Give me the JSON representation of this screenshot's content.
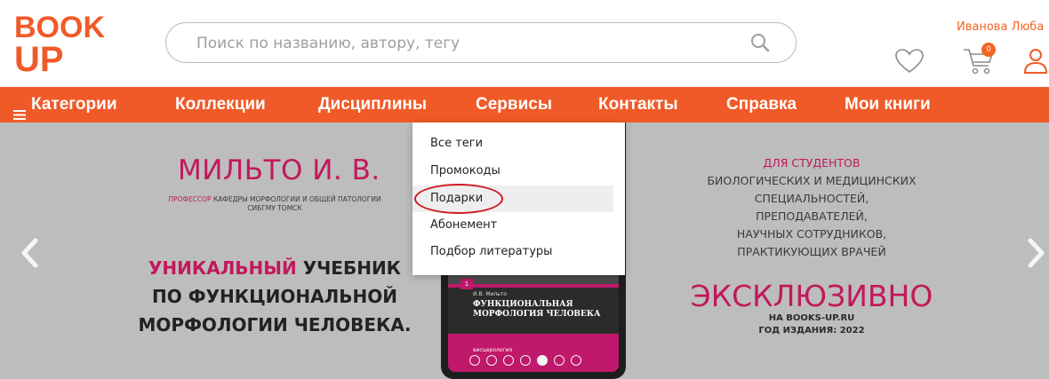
{
  "logo": {
    "line1": "BOOK",
    "line2": "UP"
  },
  "search": {
    "placeholder": "Поиск по названию, автору, тегу"
  },
  "user": {
    "name": "Иванова Люба",
    "cart_count": "0"
  },
  "nav": {
    "items": [
      "Категории",
      "Коллекции",
      "Дисциплины",
      "Сервисы",
      "Контакты",
      "Справка",
      "Мои книги"
    ]
  },
  "dropdown": {
    "items": [
      "Все теги",
      "Промокоды",
      "Подарки",
      "Абонемент",
      "Подбор литературы"
    ],
    "highlighted": "Подарки"
  },
  "banner": {
    "author": "МИЛЬТО И. В.",
    "affiliation_accent": "ПРОФЕССОР",
    "affiliation_rest": " КАФЕДРЫ МОРФОЛОГИИ И ОБЩЕЙ ПАТОЛОГИИ",
    "affiliation_line2": "СИБГМУ ТОМСК",
    "headline_accent": "УНИКАЛЬНЫЙ",
    "headline_rest": " УЧЕБНИК",
    "headline_line2": "ПО ФУНКЦИОНАЛЬНОЙ",
    "headline_line3": "МОРФОЛОГИИ ЧЕЛОВЕКА.",
    "audience_title": "ДЛЯ СТУДЕНТОВ",
    "audience_lines": [
      "БИОЛОГИЧЕСКИХ И МЕДИЦИНСКИХ",
      "СПЕЦИАЛЬНОСТЕЙ,",
      "ПРЕПОДАВАТЕЛЕЙ,",
      "НАУЧНЫХ СОТРУДНИКОВ,",
      "ПРАКТИКУЮЩИХ ВРАЧЕЙ"
    ],
    "exclusive": "ЭКСКЛЮЗИВНО",
    "site": "НА BOOKS-UP.RU",
    "year": "ГОД ИЗДАНИЯ: 2022"
  },
  "book": {
    "number": "1",
    "author": "И.В. Мильто",
    "title_line1": "ФУНКЦИОНАЛЬНАЯ",
    "title_line2": "МОРФОЛОГИЯ ЧЕЛОВЕКА",
    "subtitle": "висцерология"
  },
  "carousel": {
    "dot_count": 7,
    "active_index": 4
  },
  "colors": {
    "accent": "#f05a28",
    "brand_magenta": "#c2185b",
    "banner_bg": "#bdbdbd",
    "circle": "#d01a22"
  },
  "icons": [
    "search-icon",
    "heart-icon",
    "cart-icon",
    "user-icon",
    "menu-icon",
    "chevron-left-icon",
    "chevron-right-icon"
  ]
}
